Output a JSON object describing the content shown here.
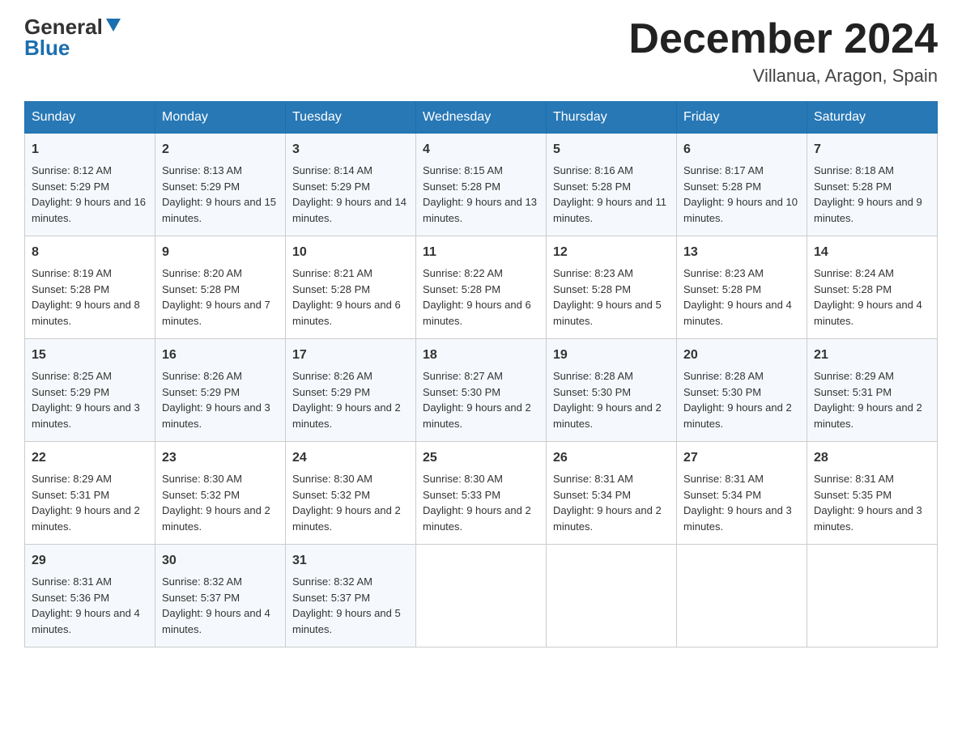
{
  "logo": {
    "general": "General",
    "blue": "Blue"
  },
  "header": {
    "title": "December 2024",
    "subtitle": "Villanua, Aragon, Spain"
  },
  "days_of_week": [
    "Sunday",
    "Monday",
    "Tuesday",
    "Wednesday",
    "Thursday",
    "Friday",
    "Saturday"
  ],
  "weeks": [
    [
      {
        "day": "1",
        "sunrise": "8:12 AM",
        "sunset": "5:29 PM",
        "daylight": "9 hours and 16 minutes."
      },
      {
        "day": "2",
        "sunrise": "8:13 AM",
        "sunset": "5:29 PM",
        "daylight": "9 hours and 15 minutes."
      },
      {
        "day": "3",
        "sunrise": "8:14 AM",
        "sunset": "5:29 PM",
        "daylight": "9 hours and 14 minutes."
      },
      {
        "day": "4",
        "sunrise": "8:15 AM",
        "sunset": "5:28 PM",
        "daylight": "9 hours and 13 minutes."
      },
      {
        "day": "5",
        "sunrise": "8:16 AM",
        "sunset": "5:28 PM",
        "daylight": "9 hours and 11 minutes."
      },
      {
        "day": "6",
        "sunrise": "8:17 AM",
        "sunset": "5:28 PM",
        "daylight": "9 hours and 10 minutes."
      },
      {
        "day": "7",
        "sunrise": "8:18 AM",
        "sunset": "5:28 PM",
        "daylight": "9 hours and 9 minutes."
      }
    ],
    [
      {
        "day": "8",
        "sunrise": "8:19 AM",
        "sunset": "5:28 PM",
        "daylight": "9 hours and 8 minutes."
      },
      {
        "day": "9",
        "sunrise": "8:20 AM",
        "sunset": "5:28 PM",
        "daylight": "9 hours and 7 minutes."
      },
      {
        "day": "10",
        "sunrise": "8:21 AM",
        "sunset": "5:28 PM",
        "daylight": "9 hours and 6 minutes."
      },
      {
        "day": "11",
        "sunrise": "8:22 AM",
        "sunset": "5:28 PM",
        "daylight": "9 hours and 6 minutes."
      },
      {
        "day": "12",
        "sunrise": "8:23 AM",
        "sunset": "5:28 PM",
        "daylight": "9 hours and 5 minutes."
      },
      {
        "day": "13",
        "sunrise": "8:23 AM",
        "sunset": "5:28 PM",
        "daylight": "9 hours and 4 minutes."
      },
      {
        "day": "14",
        "sunrise": "8:24 AM",
        "sunset": "5:28 PM",
        "daylight": "9 hours and 4 minutes."
      }
    ],
    [
      {
        "day": "15",
        "sunrise": "8:25 AM",
        "sunset": "5:29 PM",
        "daylight": "9 hours and 3 minutes."
      },
      {
        "day": "16",
        "sunrise": "8:26 AM",
        "sunset": "5:29 PM",
        "daylight": "9 hours and 3 minutes."
      },
      {
        "day": "17",
        "sunrise": "8:26 AM",
        "sunset": "5:29 PM",
        "daylight": "9 hours and 2 minutes."
      },
      {
        "day": "18",
        "sunrise": "8:27 AM",
        "sunset": "5:30 PM",
        "daylight": "9 hours and 2 minutes."
      },
      {
        "day": "19",
        "sunrise": "8:28 AM",
        "sunset": "5:30 PM",
        "daylight": "9 hours and 2 minutes."
      },
      {
        "day": "20",
        "sunrise": "8:28 AM",
        "sunset": "5:30 PM",
        "daylight": "9 hours and 2 minutes."
      },
      {
        "day": "21",
        "sunrise": "8:29 AM",
        "sunset": "5:31 PM",
        "daylight": "9 hours and 2 minutes."
      }
    ],
    [
      {
        "day": "22",
        "sunrise": "8:29 AM",
        "sunset": "5:31 PM",
        "daylight": "9 hours and 2 minutes."
      },
      {
        "day": "23",
        "sunrise": "8:30 AM",
        "sunset": "5:32 PM",
        "daylight": "9 hours and 2 minutes."
      },
      {
        "day": "24",
        "sunrise": "8:30 AM",
        "sunset": "5:32 PM",
        "daylight": "9 hours and 2 minutes."
      },
      {
        "day": "25",
        "sunrise": "8:30 AM",
        "sunset": "5:33 PM",
        "daylight": "9 hours and 2 minutes."
      },
      {
        "day": "26",
        "sunrise": "8:31 AM",
        "sunset": "5:34 PM",
        "daylight": "9 hours and 2 minutes."
      },
      {
        "day": "27",
        "sunrise": "8:31 AM",
        "sunset": "5:34 PM",
        "daylight": "9 hours and 3 minutes."
      },
      {
        "day": "28",
        "sunrise": "8:31 AM",
        "sunset": "5:35 PM",
        "daylight": "9 hours and 3 minutes."
      }
    ],
    [
      {
        "day": "29",
        "sunrise": "8:31 AM",
        "sunset": "5:36 PM",
        "daylight": "9 hours and 4 minutes."
      },
      {
        "day": "30",
        "sunrise": "8:32 AM",
        "sunset": "5:37 PM",
        "daylight": "9 hours and 4 minutes."
      },
      {
        "day": "31",
        "sunrise": "8:32 AM",
        "sunset": "5:37 PM",
        "daylight": "9 hours and 5 minutes."
      },
      null,
      null,
      null,
      null
    ]
  ],
  "labels": {
    "sunrise": "Sunrise:",
    "sunset": "Sunset:",
    "daylight": "Daylight:"
  }
}
